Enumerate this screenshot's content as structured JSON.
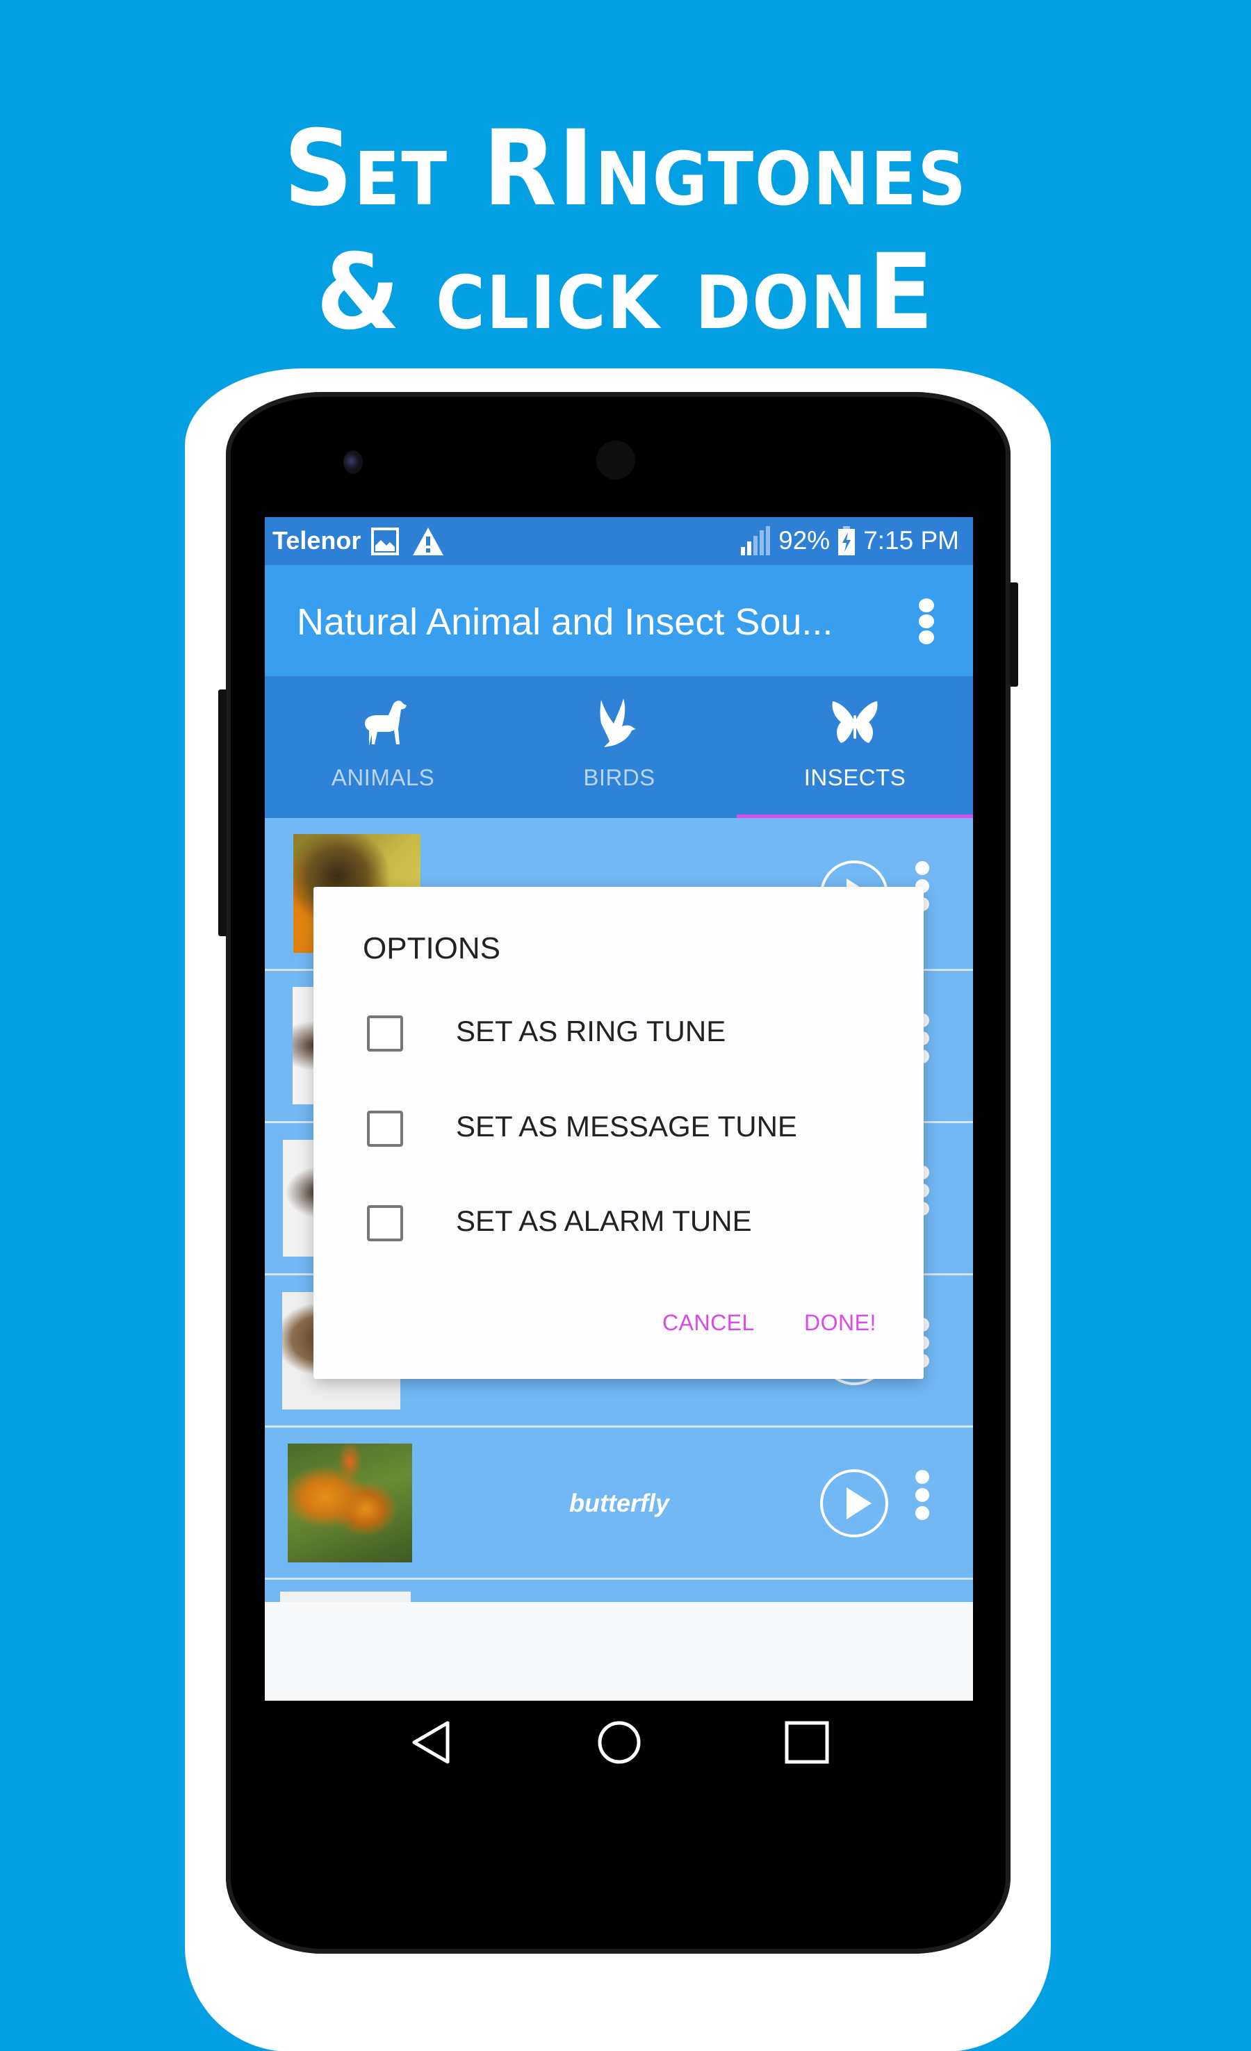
{
  "promo": {
    "headline_line1": "Set RIngtones",
    "headline_line2": "& click donE"
  },
  "status_bar": {
    "carrier": "Telenor",
    "left_icons": [
      "image-icon",
      "warning-icon"
    ],
    "signal_icon": "signal-icon",
    "battery_percent": "92%",
    "battery_icon": "battery-charging-icon",
    "time": "7:15 PM"
  },
  "app_bar": {
    "title": "Natural Animal and Insect Sou...",
    "overflow_icon": "more-vert-icon"
  },
  "tabs": [
    {
      "label": "ANIMALS",
      "icon": "dog-icon",
      "active": false
    },
    {
      "label": "BIRDS",
      "icon": "bird-icon",
      "active": false
    },
    {
      "label": "INSECTS",
      "icon": "butterfly-icon",
      "active": true
    }
  ],
  "list": {
    "items": [
      {
        "title": "",
        "thumbnail": "bee"
      },
      {
        "title": "",
        "thumbnail": "insect-on-white"
      },
      {
        "title": "",
        "thumbnail": "ant-on-white"
      },
      {
        "title": "",
        "thumbnail": "beetle"
      },
      {
        "title": "butterfly",
        "thumbnail": "monarch-butterfly"
      }
    ]
  },
  "dialog": {
    "title": "OPTIONS",
    "options": [
      {
        "label": "SET AS RING TUNE",
        "checked": false
      },
      {
        "label": "SET AS MESSAGE TUNE",
        "checked": false
      },
      {
        "label": "SET AS ALARM TUNE",
        "checked": false
      }
    ],
    "cancel_label": "CANCEL",
    "done_label": "DONE!"
  },
  "nav_bar": {
    "back": "back-icon",
    "home": "home-icon",
    "recents": "recents-icon"
  },
  "colors": {
    "background": "#029fe3",
    "status_bar": "#2e7fd6",
    "app_bar": "#389ef0",
    "tab_bar": "#2e82d8",
    "list_bg": "#72b8f5",
    "accent": "#d94ae8"
  }
}
